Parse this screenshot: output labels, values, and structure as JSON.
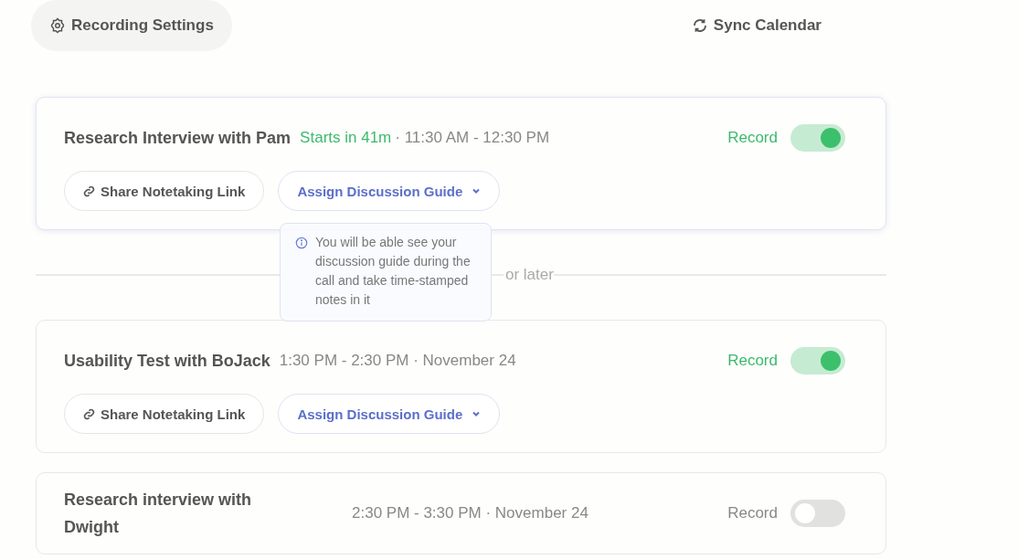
{
  "toolbar": {
    "settings_button": "Recording Settings",
    "sync_button": "Sync Calendar"
  },
  "meetings": [
    {
      "title": "Research Interview with Pam",
      "starts": "Starts in 41m",
      "time": "· 11:30 AM - 12:30 PM",
      "record_label": "Record",
      "record": true,
      "share_button": "Share Notetaking Link",
      "guide_button": "Assign Discussion Guide",
      "tooltip": "You will be able see your discussion guide during the call and take time-stamped notes in it",
      "kind": "inline"
    },
    {
      "title": "Usability Test with BoJack",
      "time": "1:30 PM - 2:30 PM · November 24",
      "record_label": "Record",
      "record": true,
      "share_button": "Share Notetaking Link",
      "guide_button": "Assign Discussion Guide",
      "kind": "inline"
    },
    {
      "title": "Research interview with Dwight",
      "time": "2:30 PM - 3:30 PM · November 24",
      "record_label": "Record",
      "record": false,
      "kind": "columns"
    }
  ],
  "divider": {
    "label": "or later"
  }
}
